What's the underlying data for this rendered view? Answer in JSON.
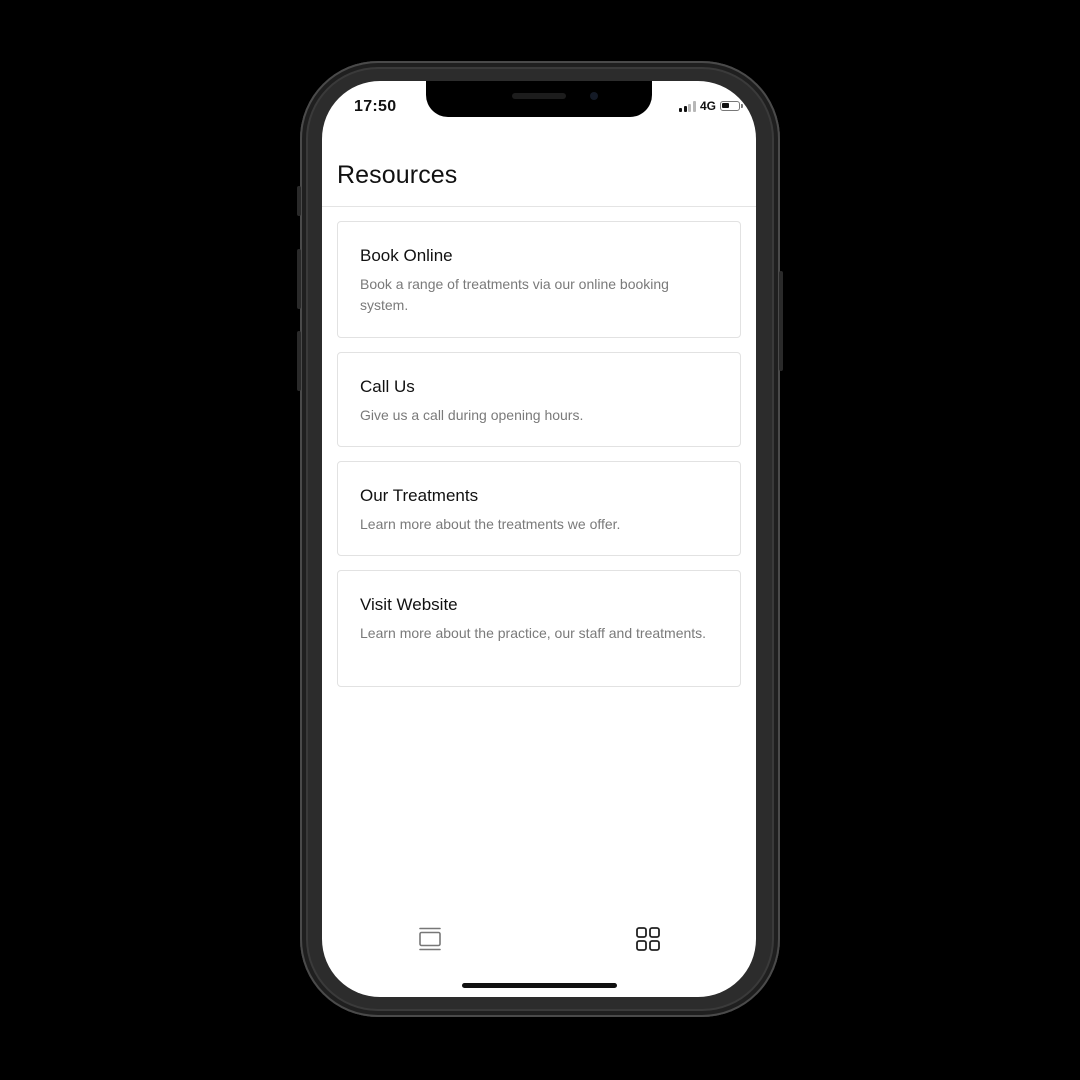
{
  "status_bar": {
    "time": "17:50",
    "network": "4G",
    "battery_level": 0.45
  },
  "header": {
    "title": "Resources"
  },
  "cards": [
    {
      "title": "Book Online",
      "description": "Book a range of treatments via our online booking system."
    },
    {
      "title": "Call Us",
      "description": "Give us a call during opening hours."
    },
    {
      "title": "Our Treatments",
      "description": "Learn more about the treatments we offer."
    },
    {
      "title": "Visit Website",
      "description": "Learn more about the practice, our staff and treatments."
    }
  ],
  "tab_bar": {
    "icons": [
      "pages-icon",
      "grid-icon"
    ]
  }
}
